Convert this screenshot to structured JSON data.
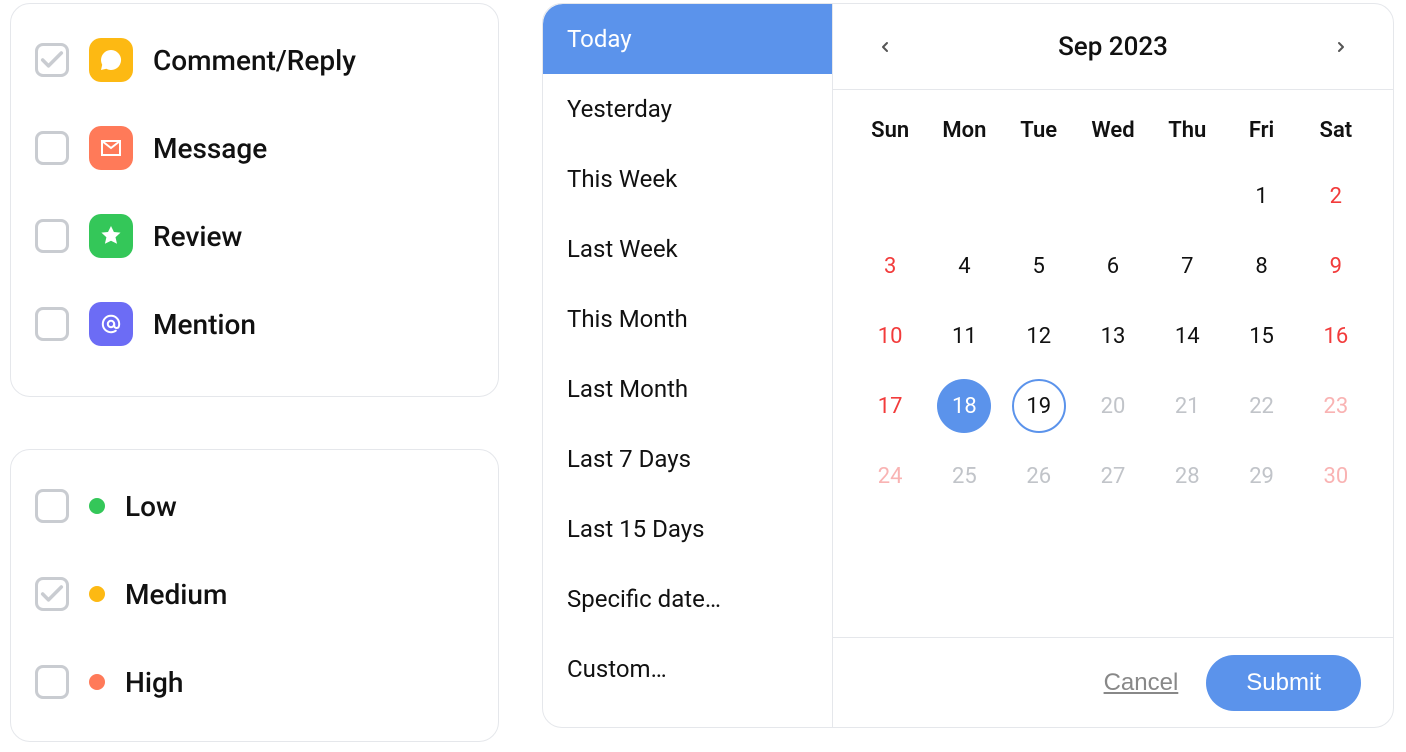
{
  "filters": {
    "types": [
      {
        "key": "comment",
        "label": "Comment/Reply",
        "checked": true,
        "icon": "comment-icon",
        "icon_class": "ic-comment"
      },
      {
        "key": "message",
        "label": "Message",
        "checked": false,
        "icon": "message-icon",
        "icon_class": "ic-message"
      },
      {
        "key": "review",
        "label": "Review",
        "checked": false,
        "icon": "star-icon",
        "icon_class": "ic-review"
      },
      {
        "key": "mention",
        "label": "Mention",
        "checked": false,
        "icon": "at-icon",
        "icon_class": "ic-mention"
      }
    ],
    "priority": [
      {
        "key": "low",
        "label": "Low",
        "checked": false,
        "dot_class": "dot-low"
      },
      {
        "key": "medium",
        "label": "Medium",
        "checked": true,
        "dot_class": "dot-med"
      },
      {
        "key": "high",
        "label": "High",
        "checked": false,
        "dot_class": "dot-high"
      }
    ]
  },
  "datepicker": {
    "presets": [
      {
        "label": "Today",
        "active": true
      },
      {
        "label": "Yesterday",
        "active": false
      },
      {
        "label": "This Week",
        "active": false
      },
      {
        "label": "Last Week",
        "active": false
      },
      {
        "label": "This Month",
        "active": false
      },
      {
        "label": "Last Month",
        "active": false
      },
      {
        "label": "Last 7 Days",
        "active": false
      },
      {
        "label": "Last 15 Days",
        "active": false
      },
      {
        "label": "Specific date…",
        "active": false
      },
      {
        "label": "Custom…",
        "active": false
      }
    ],
    "month_label": "Sep 2023",
    "weekdays": [
      "Sun",
      "Mon",
      "Tue",
      "Wed",
      "Thu",
      "Fri",
      "Sat"
    ],
    "weeks": [
      [
        {
          "n": "",
          "t": ""
        },
        {
          "n": "",
          "t": ""
        },
        {
          "n": "",
          "t": ""
        },
        {
          "n": "",
          "t": ""
        },
        {
          "n": "",
          "t": ""
        },
        {
          "n": "1",
          "t": "wd"
        },
        {
          "n": "2",
          "t": "we"
        }
      ],
      [
        {
          "n": "3",
          "t": "we"
        },
        {
          "n": "4",
          "t": "wd"
        },
        {
          "n": "5",
          "t": "wd"
        },
        {
          "n": "6",
          "t": "wd"
        },
        {
          "n": "7",
          "t": "wd"
        },
        {
          "n": "8",
          "t": "wd"
        },
        {
          "n": "9",
          "t": "we"
        }
      ],
      [
        {
          "n": "10",
          "t": "we"
        },
        {
          "n": "11",
          "t": "wd"
        },
        {
          "n": "12",
          "t": "wd"
        },
        {
          "n": "13",
          "t": "wd"
        },
        {
          "n": "14",
          "t": "wd"
        },
        {
          "n": "15",
          "t": "wd"
        },
        {
          "n": "16",
          "t": "we"
        }
      ],
      [
        {
          "n": "17",
          "t": "we"
        },
        {
          "n": "18",
          "t": "wd",
          "sel": true
        },
        {
          "n": "19",
          "t": "wd",
          "today": true
        },
        {
          "n": "20",
          "t": "wd",
          "dis": true
        },
        {
          "n": "21",
          "t": "wd",
          "dis": true
        },
        {
          "n": "22",
          "t": "wd",
          "dis": true
        },
        {
          "n": "23",
          "t": "we",
          "dis": true
        }
      ],
      [
        {
          "n": "24",
          "t": "we",
          "dis": true
        },
        {
          "n": "25",
          "t": "wd",
          "dis": true
        },
        {
          "n": "26",
          "t": "wd",
          "dis": true
        },
        {
          "n": "27",
          "t": "wd",
          "dis": true
        },
        {
          "n": "28",
          "t": "wd",
          "dis": true
        },
        {
          "n": "29",
          "t": "wd",
          "dis": true
        },
        {
          "n": "30",
          "t": "we",
          "dis": true
        }
      ]
    ],
    "cancel_label": "Cancel",
    "submit_label": "Submit"
  }
}
